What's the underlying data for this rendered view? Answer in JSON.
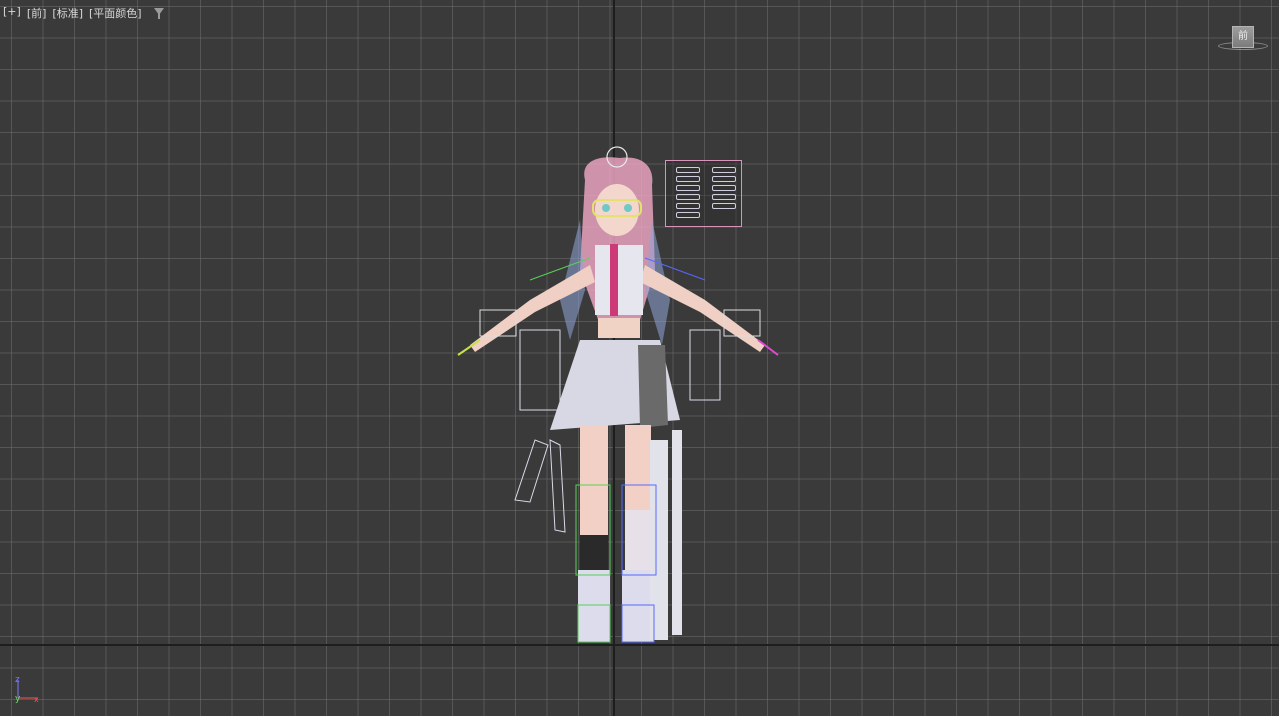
{
  "viewport": {
    "menu": {
      "plus_label": "[+]",
      "view_label": "[前]",
      "shading_label": "[标准]",
      "display_label": "[平面颜色]"
    },
    "viewcube_label": "前",
    "axis": {
      "z_label": "z",
      "y_label": "y",
      "x_label": "x"
    }
  },
  "colors": {
    "background": "#3a3a3a",
    "grid": "#6e6e6e",
    "axis_line": "#1e1e1e",
    "axis_z": "#7a7aff",
    "axis_y": "#6fdc6f",
    "axis_x": "#ff5050",
    "panel_border": "#d894b8"
  }
}
